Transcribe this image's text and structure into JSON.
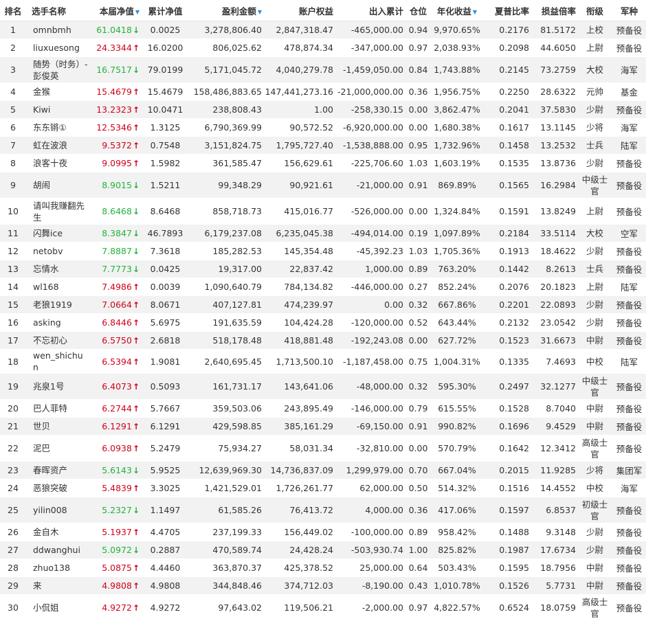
{
  "colors": {
    "up": "#d0021b",
    "down": "#22b33a",
    "sort": "#2a8fd8",
    "stripe": "#f2f2f2"
  },
  "icons": {
    "sort": "sort-down-icon",
    "up": "arrow-up-icon",
    "down": "arrow-down-icon"
  },
  "columns": [
    "排名",
    "选手名称",
    "本届净值",
    "累计净值",
    "盈利金额",
    "账户权益",
    "出入累计",
    "仓位",
    "年化收益",
    "夏普比率",
    "损益倍率",
    "衔级",
    "军种"
  ],
  "sort_arrows": {
    "2": "▼",
    "4": "▼",
    "8": "▼"
  },
  "rows": [
    {
      "rank": "1",
      "name": "omnbmh",
      "nav": "61.0418",
      "dir": "down",
      "cum": "0.0025",
      "profit": "3,278,806.40",
      "equity": "2,847,318.47",
      "flow": "-465,000.00",
      "pos": "0.94",
      "annual": "9,970.65%",
      "sharpe": "0.2176",
      "pl": "81.5172",
      "title": "上校",
      "branch": "预备役"
    },
    {
      "rank": "2",
      "name": "liuxuesong",
      "nav": "24.3344",
      "dir": "up",
      "cum": "16.0200",
      "profit": "806,025.62",
      "equity": "478,874.34",
      "flow": "-347,000.00",
      "pos": "0.97",
      "annual": "2,038.93%",
      "sharpe": "0.2098",
      "pl": "44.6050",
      "title": "上尉",
      "branch": "预备役"
    },
    {
      "rank": "3",
      "name": "随势（时务）-彭俊英",
      "nav": "16.7517",
      "dir": "down",
      "cum": "79.0199",
      "profit": "5,171,045.72",
      "equity": "4,040,279.78",
      "flow": "-1,459,050.00",
      "pos": "0.84",
      "annual": "1,743.88%",
      "sharpe": "0.2145",
      "pl": "73.2759",
      "title": "大校",
      "branch": "海军",
      "tall": true
    },
    {
      "rank": "4",
      "name": "金猴",
      "nav": "15.4679",
      "dir": "up",
      "cum": "15.4679",
      "profit": "158,486,883.65",
      "equity": "147,441,273.16",
      "flow": "-21,000,000.00",
      "pos": "0.36",
      "annual": "1,956.75%",
      "sharpe": "0.2250",
      "pl": "28.6322",
      "title": "元帅",
      "branch": "基金"
    },
    {
      "rank": "5",
      "name": "Kiwi",
      "nav": "13.2323",
      "dir": "up",
      "cum": "10.0471",
      "profit": "238,808.43",
      "equity": "1.00",
      "flow": "-258,330.15",
      "pos": "0.00",
      "annual": "3,862.47%",
      "sharpe": "0.2041",
      "pl": "37.5830",
      "title": "少尉",
      "branch": "预备役"
    },
    {
      "rank": "6",
      "name": "东东锵①",
      "nav": "12.5346",
      "dir": "up",
      "cum": "1.3125",
      "profit": "6,790,369.99",
      "equity": "90,572.52",
      "flow": "-6,920,000.00",
      "pos": "0.00",
      "annual": "1,680.38%",
      "sharpe": "0.1617",
      "pl": "13.1145",
      "title": "少将",
      "branch": "海军"
    },
    {
      "rank": "7",
      "name": "虹在波浪",
      "nav": "9.5372",
      "dir": "up",
      "cum": "0.7548",
      "profit": "3,151,824.75",
      "equity": "1,795,727.40",
      "flow": "-1,538,888.00",
      "pos": "0.95",
      "annual": "1,732.96%",
      "sharpe": "0.1458",
      "pl": "13.2532",
      "title": "士兵",
      "branch": "陆军"
    },
    {
      "rank": "8",
      "name": "浪客十夜",
      "nav": "9.0995",
      "dir": "up",
      "cum": "1.5982",
      "profit": "361,585.47",
      "equity": "156,629.61",
      "flow": "-225,706.60",
      "pos": "1.03",
      "annual": "1,603.19%",
      "sharpe": "0.1535",
      "pl": "13.8736",
      "title": "少尉",
      "branch": "预备役"
    },
    {
      "rank": "9",
      "name": "胡闹",
      "nav": "8.9015",
      "dir": "down",
      "cum": "1.5211",
      "profit": "99,348.29",
      "equity": "90,921.61",
      "flow": "-21,000.00",
      "pos": "0.91",
      "annual": "869.89%",
      "sharpe": "0.1565",
      "pl": "16.2984",
      "title": "中级士官",
      "branch": "预备役",
      "tall": true
    },
    {
      "rank": "10",
      "name": "请叫我赚翻先生",
      "nav": "8.6468",
      "dir": "down",
      "cum": "8.6468",
      "profit": "858,718.73",
      "equity": "415,016.77",
      "flow": "-526,000.00",
      "pos": "0.00",
      "annual": "1,324.84%",
      "sharpe": "0.1591",
      "pl": "13.8249",
      "title": "上尉",
      "branch": "预备役",
      "tall": true
    },
    {
      "rank": "11",
      "name": "闪舞ice",
      "nav": "8.3847",
      "dir": "down",
      "cum": "46.7893",
      "profit": "6,179,237.08",
      "equity": "6,235,045.38",
      "flow": "-494,014.00",
      "pos": "0.19",
      "annual": "1,097.89%",
      "sharpe": "0.2184",
      "pl": "33.5114",
      "title": "大校",
      "branch": "空军"
    },
    {
      "rank": "12",
      "name": "netobv",
      "nav": "7.8887",
      "dir": "down",
      "cum": "7.3618",
      "profit": "185,282.53",
      "equity": "145,354.48",
      "flow": "-45,392.23",
      "pos": "1.03",
      "annual": "1,705.36%",
      "sharpe": "0.1913",
      "pl": "18.4622",
      "title": "少尉",
      "branch": "预备役"
    },
    {
      "rank": "13",
      "name": "忘情水",
      "nav": "7.7773",
      "dir": "down",
      "cum": "0.0425",
      "profit": "19,317.00",
      "equity": "22,837.42",
      "flow": "1,000.00",
      "pos": "0.89",
      "annual": "763.20%",
      "sharpe": "0.1442",
      "pl": "8.2613",
      "title": "士兵",
      "branch": "预备役"
    },
    {
      "rank": "14",
      "name": "wl168",
      "nav": "7.4986",
      "dir": "up",
      "cum": "0.0039",
      "profit": "1,090,640.79",
      "equity": "784,134.82",
      "flow": "-446,000.00",
      "pos": "0.27",
      "annual": "852.24%",
      "sharpe": "0.2076",
      "pl": "20.1823",
      "title": "上尉",
      "branch": "陆军"
    },
    {
      "rank": "15",
      "name": "老狼1919",
      "nav": "7.0664",
      "dir": "up",
      "cum": "8.0671",
      "profit": "407,127.81",
      "equity": "474,239.97",
      "flow": "0.00",
      "pos": "0.32",
      "annual": "667.86%",
      "sharpe": "0.2201",
      "pl": "22.0893",
      "title": "少尉",
      "branch": "预备役"
    },
    {
      "rank": "16",
      "name": "asking",
      "nav": "6.8446",
      "dir": "up",
      "cum": "5.6975",
      "profit": "191,635.59",
      "equity": "104,424.28",
      "flow": "-120,000.00",
      "pos": "0.52",
      "annual": "643.44%",
      "sharpe": "0.2132",
      "pl": "23.0542",
      "title": "少尉",
      "branch": "预备役"
    },
    {
      "rank": "17",
      "name": "不忘初心",
      "nav": "6.5750",
      "dir": "up",
      "cum": "2.6818",
      "profit": "518,178.48",
      "equity": "418,881.48",
      "flow": "-192,243.08",
      "pos": "0.00",
      "annual": "627.72%",
      "sharpe": "0.1523",
      "pl": "31.6673",
      "title": "中尉",
      "branch": "预备役"
    },
    {
      "rank": "18",
      "name": "wen_shichun",
      "nav": "6.5394",
      "dir": "up",
      "cum": "1.9081",
      "profit": "2,640,695.45",
      "equity": "1,713,500.10",
      "flow": "-1,187,458.00",
      "pos": "0.75",
      "annual": "1,004.31%",
      "sharpe": "0.1335",
      "pl": "7.4693",
      "title": "中校",
      "branch": "陆军"
    },
    {
      "rank": "19",
      "name": "兆泉1号",
      "nav": "6.4073",
      "dir": "up",
      "cum": "0.5093",
      "profit": "161,731.17",
      "equity": "143,641.06",
      "flow": "-48,000.00",
      "pos": "0.32",
      "annual": "595.30%",
      "sharpe": "0.2497",
      "pl": "32.1277",
      "title": "中级士官",
      "branch": "预备役",
      "tall": true
    },
    {
      "rank": "20",
      "name": "巴人菲特",
      "nav": "6.2744",
      "dir": "up",
      "cum": "5.7667",
      "profit": "359,503.06",
      "equity": "243,895.49",
      "flow": "-146,000.00",
      "pos": "0.79",
      "annual": "615.55%",
      "sharpe": "0.1528",
      "pl": "8.7040",
      "title": "中尉",
      "branch": "预备役"
    },
    {
      "rank": "21",
      "name": "世贝",
      "nav": "6.1291",
      "dir": "up",
      "cum": "6.1291",
      "profit": "429,598.85",
      "equity": "385,161.29",
      "flow": "-69,150.00",
      "pos": "0.91",
      "annual": "990.82%",
      "sharpe": "0.1696",
      "pl": "9.4529",
      "title": "中尉",
      "branch": "预备役"
    },
    {
      "rank": "22",
      "name": "泥巴",
      "nav": "6.0938",
      "dir": "up",
      "cum": "5.2479",
      "profit": "75,934.27",
      "equity": "58,031.34",
      "flow": "-32,810.00",
      "pos": "0.00",
      "annual": "570.79%",
      "sharpe": "0.1642",
      "pl": "12.3412",
      "title": "高级士官",
      "branch": "预备役",
      "tall": true
    },
    {
      "rank": "23",
      "name": "春晖资产",
      "nav": "5.6143",
      "dir": "down",
      "cum": "5.9525",
      "profit": "12,639,969.30",
      "equity": "14,736,837.09",
      "flow": "1,299,979.00",
      "pos": "0.70",
      "annual": "667.04%",
      "sharpe": "0.2015",
      "pl": "11.9285",
      "title": "少将",
      "branch": "集团军"
    },
    {
      "rank": "24",
      "name": "恶狼突破",
      "nav": "5.4839",
      "dir": "up",
      "cum": "3.3025",
      "profit": "1,421,529.01",
      "equity": "1,726,261.77",
      "flow": "62,000.00",
      "pos": "0.50",
      "annual": "514.32%",
      "sharpe": "0.1516",
      "pl": "14.4552",
      "title": "中校",
      "branch": "海军"
    },
    {
      "rank": "25",
      "name": "yilin008",
      "nav": "5.2327",
      "dir": "down",
      "cum": "1.1497",
      "profit": "61,585.26",
      "equity": "76,413.72",
      "flow": "4,000.00",
      "pos": "0.36",
      "annual": "417.06%",
      "sharpe": "0.1597",
      "pl": "6.8537",
      "title": "初级士官",
      "branch": "预备役",
      "tall": true
    },
    {
      "rank": "26",
      "name": "金自木",
      "nav": "5.1937",
      "dir": "up",
      "cum": "4.4705",
      "profit": "237,199.33",
      "equity": "156,449.02",
      "flow": "-100,000.00",
      "pos": "0.89",
      "annual": "958.42%",
      "sharpe": "0.1488",
      "pl": "9.3148",
      "title": "少尉",
      "branch": "预备役"
    },
    {
      "rank": "27",
      "name": "ddwanghui",
      "nav": "5.0972",
      "dir": "down",
      "cum": "0.2887",
      "profit": "470,589.74",
      "equity": "24,428.24",
      "flow": "-503,930.74",
      "pos": "1.00",
      "annual": "825.82%",
      "sharpe": "0.1987",
      "pl": "17.6734",
      "title": "少尉",
      "branch": "预备役"
    },
    {
      "rank": "28",
      "name": "zhuo138",
      "nav": "5.0875",
      "dir": "up",
      "cum": "4.4460",
      "profit": "363,870.37",
      "equity": "425,378.52",
      "flow": "25,000.00",
      "pos": "0.64",
      "annual": "503.43%",
      "sharpe": "0.1595",
      "pl": "18.7956",
      "title": "中尉",
      "branch": "预备役"
    },
    {
      "rank": "29",
      "name": "来",
      "nav": "4.9808",
      "dir": "up",
      "cum": "4.9808",
      "profit": "344,848.46",
      "equity": "374,712.03",
      "flow": "-8,190.00",
      "pos": "0.43",
      "annual": "1,010.78%",
      "sharpe": "0.1526",
      "pl": "5.7731",
      "title": "中尉",
      "branch": "预备役"
    },
    {
      "rank": "30",
      "name": "小侃姐",
      "nav": "4.9272",
      "dir": "up",
      "cum": "4.9272",
      "profit": "97,643.02",
      "equity": "119,506.21",
      "flow": "-2,000.00",
      "pos": "0.97",
      "annual": "4,822.57%",
      "sharpe": "0.6524",
      "pl": "18.0759",
      "title": "高级士官",
      "branch": "预备役",
      "tall": true
    }
  ]
}
